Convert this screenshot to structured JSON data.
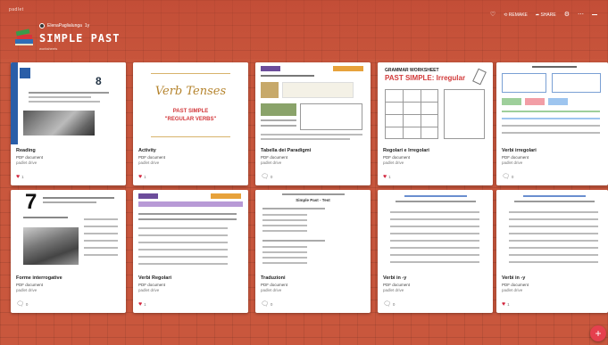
{
  "app": {
    "name": "padlet"
  },
  "header": {
    "owner": "ElenaPaglialunga",
    "time": "1y",
    "title": "SIMPLE PAST",
    "subtitle": "worksheets"
  },
  "actions": {
    "remake": "REMAKE",
    "share": "SHARE",
    "more": "⋯"
  },
  "cards": [
    {
      "title": "Reading",
      "type": "PDF document",
      "source": "padlet drive",
      "reaction": "heart",
      "count": "1"
    },
    {
      "title": "Activity",
      "type": "PDF document",
      "source": "padlet drive",
      "reaction": "heart",
      "count": "1"
    },
    {
      "title": "Tabella dei Paradigmi",
      "type": "PDF document",
      "source": "padlet drive",
      "reaction": "comment",
      "count": "0"
    },
    {
      "title": "Regolari e Irregolari",
      "type": "PDF document",
      "source": "padlet drive",
      "reaction": "heart",
      "count": "1"
    },
    {
      "title": "Verbi irregolari",
      "type": "PDF document",
      "source": "padlet drive",
      "reaction": "comment",
      "count": "0"
    },
    {
      "title": "Forme interrogative",
      "type": "PDF document",
      "source": "padlet drive",
      "reaction": "comment",
      "count": "0"
    },
    {
      "title": "Verbi Regolari",
      "type": "PDF document",
      "source": "padlet drive",
      "reaction": "heart",
      "count": "1"
    },
    {
      "title": "Traduzioni",
      "type": "PDF document",
      "source": "padlet drive",
      "reaction": "comment",
      "count": "0"
    },
    {
      "title": "Verbi in -y",
      "type": "PDF document",
      "source": "padlet drive",
      "reaction": "comment",
      "count": "0"
    },
    {
      "title": "Verbi in -y",
      "type": "PDF document",
      "source": "padlet drive",
      "reaction": "heart",
      "count": "1"
    }
  ],
  "thumbs": {
    "t1_number": "8",
    "t2_line1": "Verb Tenses",
    "t2_line2": "PAST SIMPLE",
    "t2_line3": "\"REGULAR VERBS\"",
    "t4_line1": "GRAMMAR WORKSHEET",
    "t4_line2": "PAST SIMPLE: Irregular",
    "t6_number": "7",
    "t8_heading": "Simple Past - Test"
  },
  "colors": {
    "brick": "#c9573d",
    "heart": "#d1233b",
    "fab": "#e5404e"
  }
}
